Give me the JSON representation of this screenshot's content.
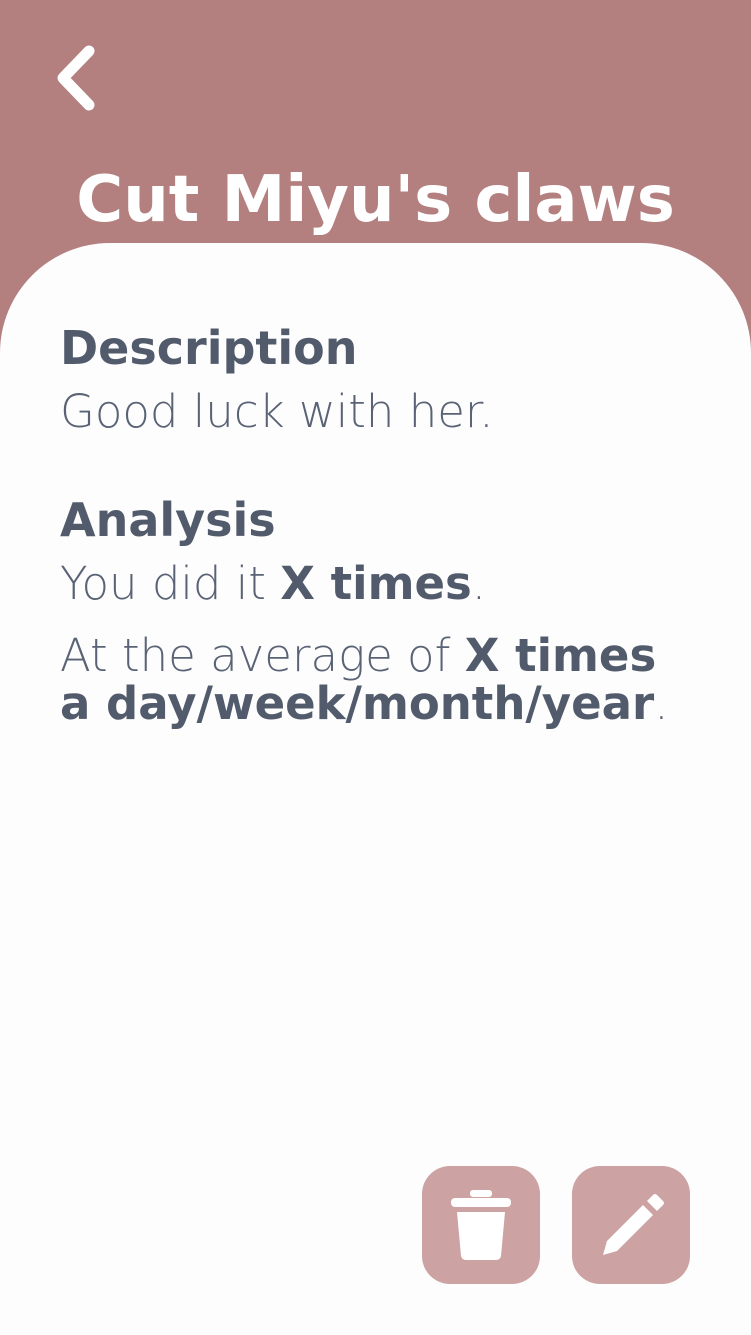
{
  "header": {
    "back_icon": "chevron-left-icon",
    "title": "Cut Miyu's claws"
  },
  "description": {
    "heading": "Description",
    "text": "Good luck with her."
  },
  "analysis": {
    "heading": "Analysis",
    "line1_prefix": "You did it ",
    "line1_value": "X times",
    "line1_suffix": ".",
    "line2_prefix": "At the average of ",
    "line2_value": "X times a day/week/month/year",
    "line2_suffix": "."
  },
  "actions": {
    "delete_icon": "trash-icon",
    "edit_icon": "pencil-icon"
  },
  "colors": {
    "header_bg": "#b3807f",
    "button_bg": "#cca3a2",
    "text": "#525b6c"
  }
}
